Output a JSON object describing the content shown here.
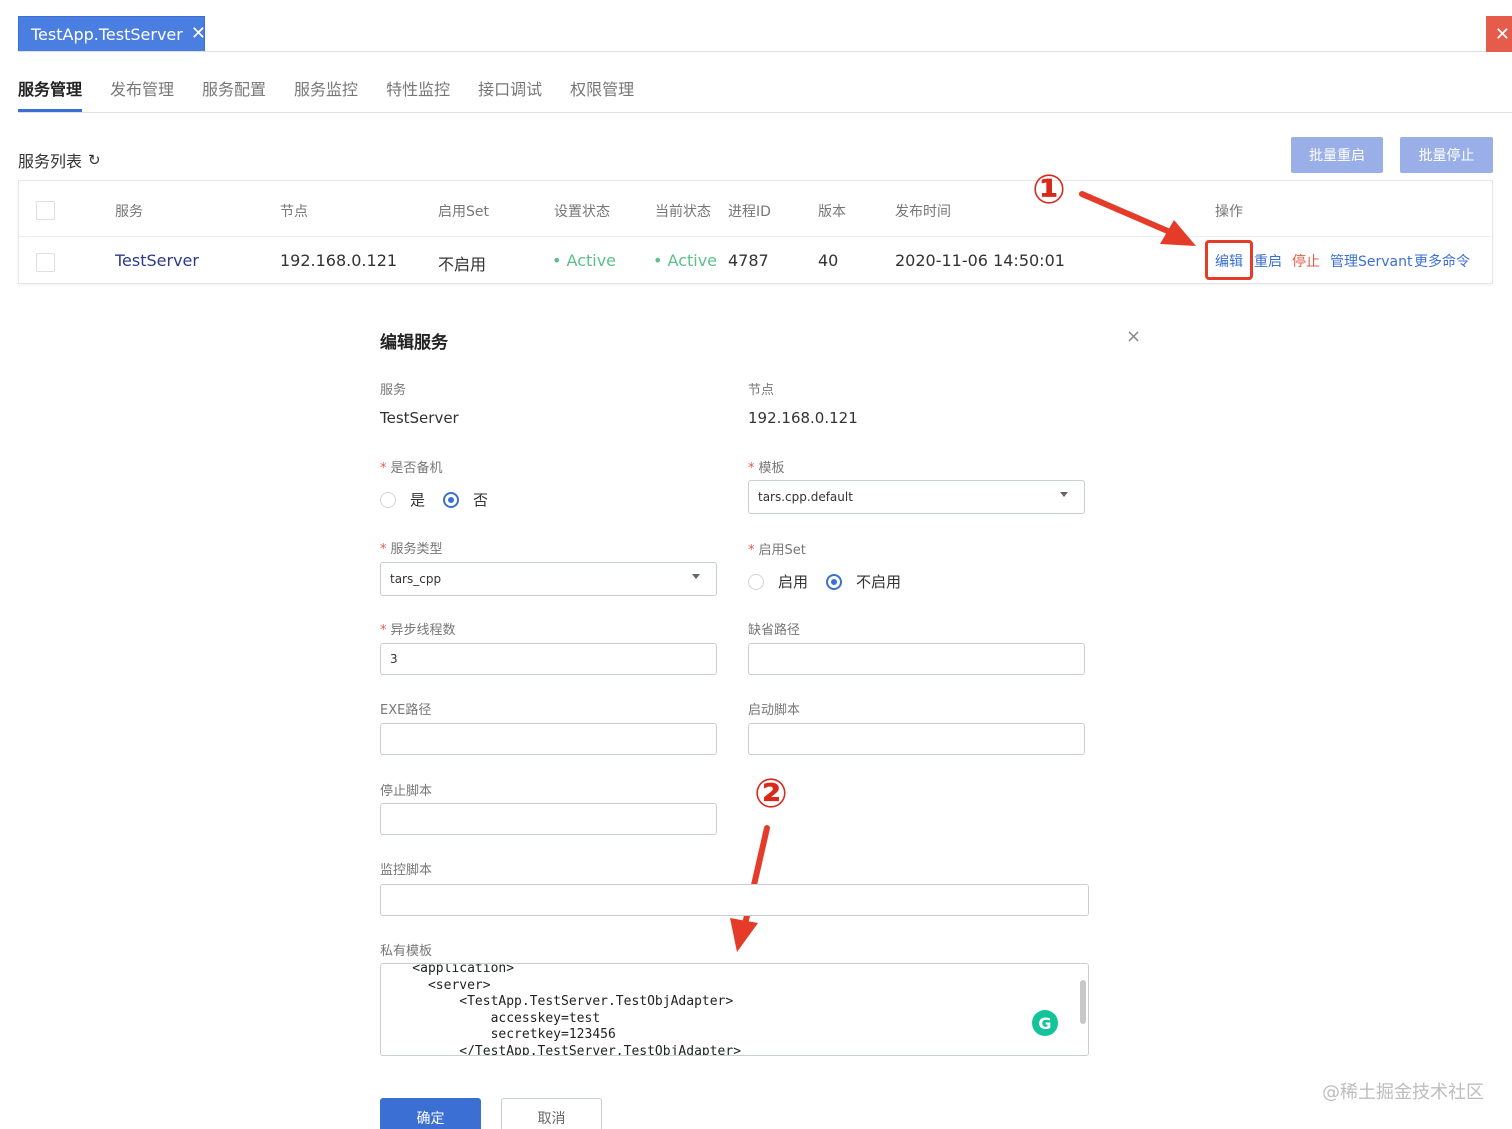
{
  "window": {
    "tab_title": "TestApp.TestServer",
    "tab_close": "✕",
    "corner_close": "✕"
  },
  "nav": {
    "tabs": [
      "服务管理",
      "发布管理",
      "服务配置",
      "服务监控",
      "特性监控",
      "接口调试",
      "权限管理"
    ]
  },
  "service_list": {
    "title": "服务列表",
    "refresh_icon": "↻",
    "batch_restart": "批量重启",
    "batch_stop": "批量停止",
    "columns": [
      "服务",
      "节点",
      "启用Set",
      "设置状态",
      "当前状态",
      "进程ID",
      "版本",
      "发布时间",
      "操作"
    ],
    "row": {
      "service": "TestServer",
      "node": "192.168.0.121",
      "set_enabled": "不启用",
      "setting_status": "• Active",
      "current_status": "• Active",
      "pid": "4787",
      "version": "40",
      "release_time": "2020-11-06 14:50:01",
      "ops": {
        "edit": "编辑",
        "restart": "重启",
        "stop": "停止",
        "manage_servant": "管理Servant",
        "more": "更多命令"
      }
    }
  },
  "annotations": {
    "one": "①",
    "two": "②",
    "color": "#e53c2a"
  },
  "modal": {
    "title": "编辑服务",
    "close": "×",
    "service_label": "服务",
    "service_value": "TestServer",
    "node_label": "节点",
    "node_value": "192.168.0.121",
    "standby_label": "是否备机",
    "standby_yes": "是",
    "standby_no": "否",
    "template_label": "模板",
    "template_value": "tars.cpp.default",
    "service_type_label": "服务类型",
    "service_type_value": "tars_cpp",
    "set_label": "启用Set",
    "set_enable": "启用",
    "set_disable": "不启用",
    "async_threads_label": "异步线程数",
    "async_threads_value": "3",
    "default_path_label": "缺省路径",
    "exe_path_label": "EXE路径",
    "start_script_label": "启动脚本",
    "stop_script_label": "停止脚本",
    "monitor_script_label": "监控脚本",
    "private_template_label": "私有模板",
    "private_template_value": "    <application>\n      <server>\n          <TestApp.TestServer.TestObjAdapter>\n              accesskey=test\n              secretkey=123456\n          </TestApp.TestServer.TestObjAdapter>",
    "grammarly_icon": "G",
    "confirm": "确定",
    "cancel": "取消"
  },
  "watermark": "@稀土掘金技术社区"
}
